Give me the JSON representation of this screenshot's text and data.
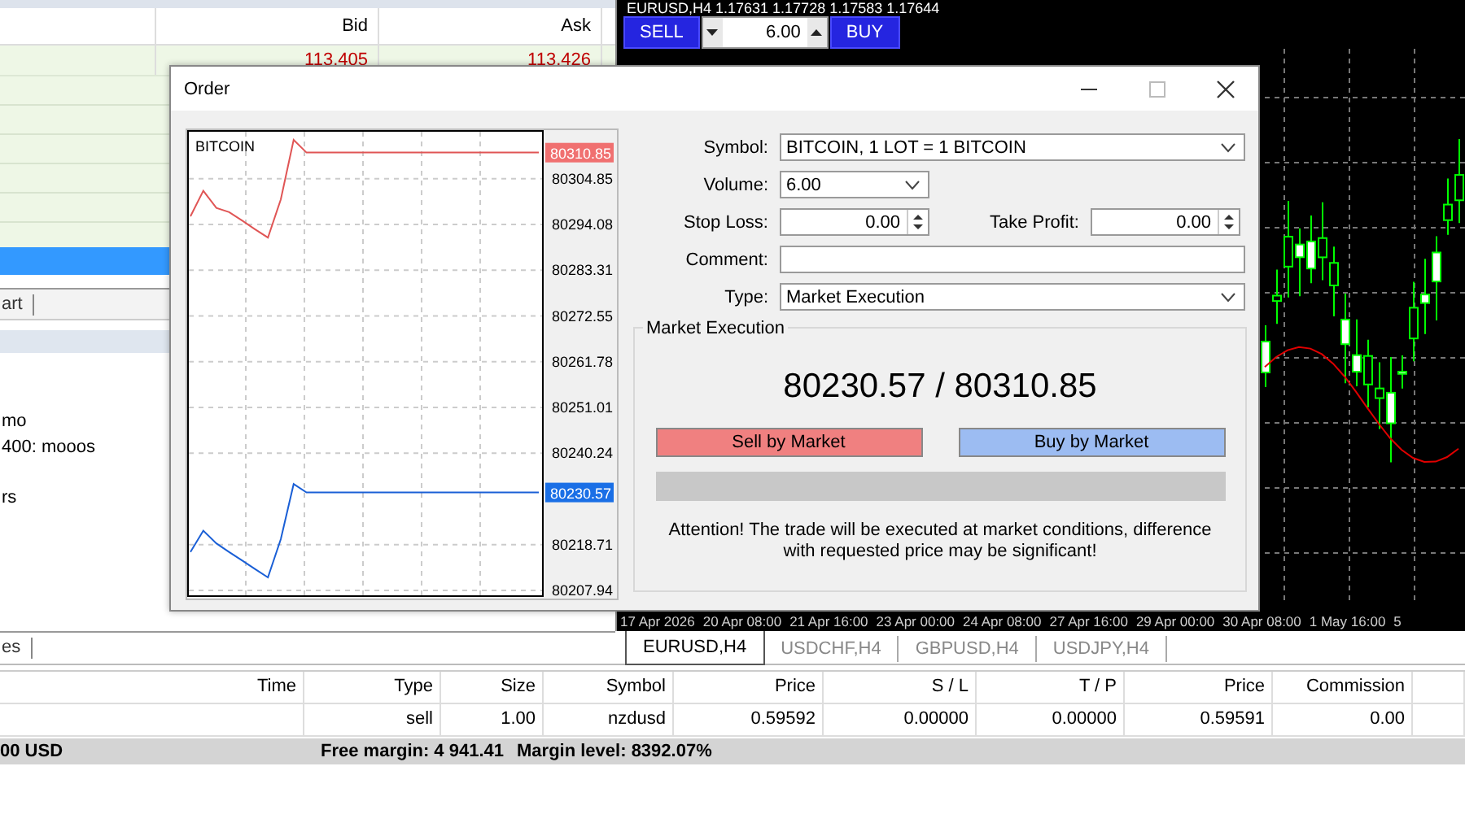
{
  "market_watch": {
    "columns": [
      "Bid",
      "Ask"
    ],
    "rows": [
      {
        "bid": "113.405",
        "ask": "113.426"
      }
    ],
    "tab": "art"
  },
  "navigator": {
    "items": [
      "mo",
      "400: mooos",
      "rs"
    ],
    "tab": "es"
  },
  "chart": {
    "title": "EURUSD,H4  1.17631 1.17728 1.17583 1.17644",
    "sell": "SELL",
    "volume": "6.00",
    "buy": "BUY",
    "time_axis": [
      "17 Apr 2026",
      "20 Apr 08:00",
      "21 Apr 16:00",
      "23 Apr 00:00",
      "24 Apr 08:00",
      "27 Apr 16:00",
      "29 Apr 00:00",
      "30 Apr 08:00",
      "1 May 16:00",
      "5"
    ]
  },
  "chart_tabs": [
    {
      "label": "EURUSD,H4",
      "selected": true
    },
    {
      "label": "USDCHF,H4",
      "selected": false
    },
    {
      "label": "GBPUSD,H4",
      "selected": false
    },
    {
      "label": "USDJPY,H4",
      "selected": false
    }
  ],
  "trade_table": {
    "columns": [
      "Time",
      "Type",
      "Size",
      "Symbol",
      "Price",
      "S / L",
      "T / P",
      "Price",
      "Commission"
    ],
    "rows": [
      {
        "cells": [
          "",
          "sell",
          "1.00",
          "nzdusd",
          "0.59592",
          "0.00000",
          "0.00000",
          "0.59591",
          "0.00"
        ]
      }
    ]
  },
  "status_bar": [
    "00 USD",
    "Free margin: 4 941.41",
    "Margin level: 8392.07%"
  ],
  "order_dialog": {
    "title": "Order",
    "chart": {
      "label": "BITCOIN",
      "chart_data": {
        "type": "line",
        "grid": true,
        "ylim": [
          80206.8,
          80316.3
        ],
        "yticks": [
          80304.85,
          80294.08,
          80283.31,
          80272.55,
          80261.78,
          80251.01,
          80240.24,
          80218.71,
          80207.94
        ],
        "series": [
          {
            "color": "#e05555",
            "values": [
              80296,
              80302,
              80298,
              80297,
              80295,
              80293,
              80291,
              80300,
              80314,
              80311,
              80311,
              80311,
              80311,
              80311,
              80311,
              80311,
              80311,
              80311,
              80311,
              80311,
              80311,
              80311,
              80311,
              80311,
              80311,
              80311,
              80311,
              80311
            ]
          },
          {
            "color": "#1a5fd6",
            "values": [
              80217,
              80222,
              80219,
              80217,
              80215,
              80213,
              80211,
              80220,
              80233,
              80231,
              80231,
              80231,
              80231,
              80231,
              80231,
              80231,
              80231,
              80231,
              80231,
              80231,
              80231,
              80231,
              80231,
              80231,
              80231,
              80231,
              80231,
              80231
            ]
          }
        ]
      },
      "price_tags": [
        {
          "text": "80310.85",
          "color": "#f07070"
        },
        {
          "text": "80230.57",
          "color": "#1a6fe6"
        }
      ]
    },
    "form": {
      "symbol_label": "Symbol:",
      "symbol": "BITCOIN, 1 LOT = 1 BITCOIN",
      "volume_label": "Volume:",
      "volume": "6.00",
      "stop_loss_label": "Stop Loss:",
      "stop_loss": "0.00",
      "take_profit_label": "Take Profit:",
      "take_profit": "0.00",
      "comment_label": "Comment:",
      "type_label": "Type:",
      "type": "Market Execution"
    },
    "execution": {
      "title": "Market Execution",
      "prices": "80230.57 / 80310.85",
      "sell_button": "Sell by Market",
      "buy_button": "Buy by Market",
      "progress": {
        "level": 0
      },
      "attention": "Attention! The trade will be executed at market conditions, difference with requested price may be significant!"
    }
  }
}
